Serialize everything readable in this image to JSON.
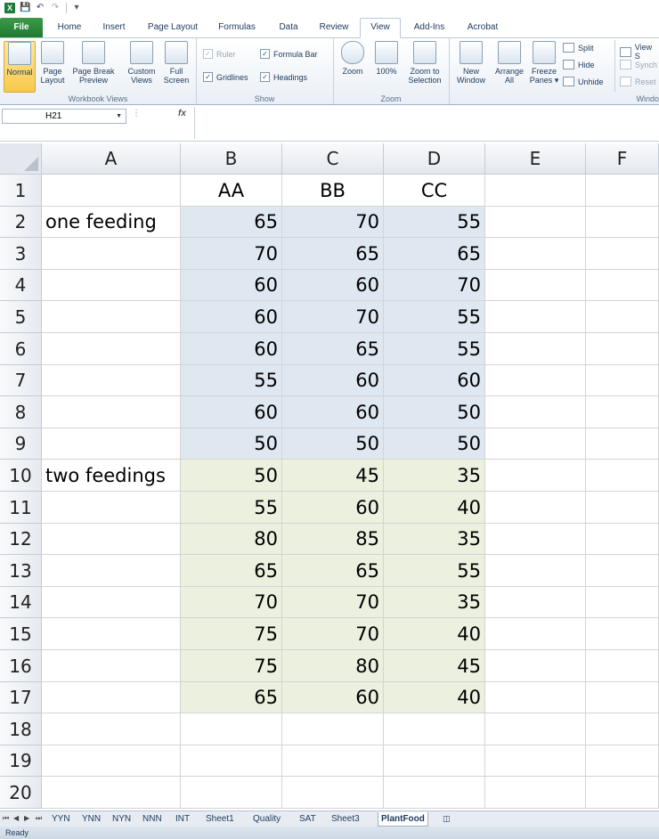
{
  "quick_access": {
    "app_icon": "excel-icon",
    "save_icon": "save-icon",
    "undo_icon": "undo-icon",
    "redo_icon": "redo-icon"
  },
  "ribbon_tabs": [
    "File",
    "Home",
    "Insert",
    "Page Layout",
    "Formulas",
    "Data",
    "Review",
    "View",
    "Add-Ins",
    "Acrobat"
  ],
  "active_tab": "View",
  "ribbon": {
    "workbook_views": {
      "label": "Workbook Views",
      "normal": "Normal",
      "page_layout_1": "Page",
      "page_layout_2": "Layout",
      "page_break_1": "Page Break",
      "page_break_2": "Preview",
      "custom_views_1": "Custom",
      "custom_views_2": "Views",
      "full_screen_1": "Full",
      "full_screen_2": "Screen"
    },
    "show": {
      "label": "Show",
      "ruler": "Ruler",
      "formula_bar": "Formula Bar",
      "gridlines": "Gridlines",
      "headings": "Headings"
    },
    "zoom": {
      "label": "Zoom",
      "zoom": "Zoom",
      "hundred": "100%",
      "zoom_sel_1": "Zoom to",
      "zoom_sel_2": "Selection"
    },
    "window": {
      "label": "Windo",
      "new_window_1": "New",
      "new_window_2": "Window",
      "arrange_1": "Arrange",
      "arrange_2": "All",
      "freeze_1": "Freeze",
      "freeze_2": "Panes ▾",
      "split": "Split",
      "hide": "Hide",
      "unhide": "Unhide",
      "view_side": "View S",
      "synch": "Synch",
      "reset": "Reset"
    }
  },
  "formula_bar": {
    "name_box": "H21",
    "fx": "fx",
    "value": ""
  },
  "columns": [
    "A",
    "B",
    "C",
    "D",
    "E",
    "F"
  ],
  "rows": [
    {
      "n": "1",
      "a": "",
      "b": "AA",
      "c": "BB",
      "d": "CC"
    },
    {
      "n": "2",
      "a": "one feeding",
      "b": "65",
      "c": "70",
      "d": "55"
    },
    {
      "n": "3",
      "a": "",
      "b": "70",
      "c": "65",
      "d": "65"
    },
    {
      "n": "4",
      "a": "",
      "b": "60",
      "c": "60",
      "d": "70"
    },
    {
      "n": "5",
      "a": "",
      "b": "60",
      "c": "70",
      "d": "55"
    },
    {
      "n": "6",
      "a": "",
      "b": "60",
      "c": "65",
      "d": "55"
    },
    {
      "n": "7",
      "a": "",
      "b": "55",
      "c": "60",
      "d": "60"
    },
    {
      "n": "8",
      "a": "",
      "b": "60",
      "c": "60",
      "d": "50"
    },
    {
      "n": "9",
      "a": "",
      "b": "50",
      "c": "50",
      "d": "50"
    },
    {
      "n": "10",
      "a": "two feedings",
      "b": "50",
      "c": "45",
      "d": "35"
    },
    {
      "n": "11",
      "a": "",
      "b": "55",
      "c": "60",
      "d": "40"
    },
    {
      "n": "12",
      "a": "",
      "b": "80",
      "c": "85",
      "d": "35"
    },
    {
      "n": "13",
      "a": "",
      "b": "65",
      "c": "65",
      "d": "55"
    },
    {
      "n": "14",
      "a": "",
      "b": "70",
      "c": "70",
      "d": "35"
    },
    {
      "n": "15",
      "a": "",
      "b": "75",
      "c": "70",
      "d": "40"
    },
    {
      "n": "16",
      "a": "",
      "b": "75",
      "c": "80",
      "d": "45"
    },
    {
      "n": "17",
      "a": "",
      "b": "65",
      "c": "60",
      "d": "40"
    },
    {
      "n": "18",
      "a": "",
      "b": "",
      "c": "",
      "d": ""
    },
    {
      "n": "19",
      "a": "",
      "b": "",
      "c": "",
      "d": ""
    },
    {
      "n": "20",
      "a": "",
      "b": "",
      "c": "",
      "d": ""
    }
  ],
  "fill_colors": {
    "one_feeding": "#dfe7f1",
    "two_feedings": "#ebf0df"
  },
  "sheet_tabs": [
    "YYN",
    "YNN",
    "NYN",
    "NNN",
    "INT",
    "Sheet1",
    "Quality",
    "SAT",
    "Sheet3",
    "PlantFood"
  ],
  "active_sheet": "PlantFood",
  "status": "Ready"
}
